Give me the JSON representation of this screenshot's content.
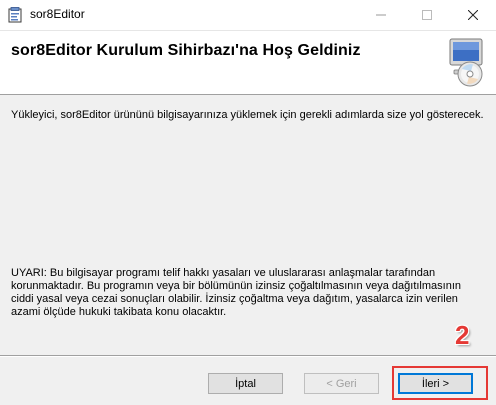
{
  "window": {
    "title": "sor8Editor",
    "icons": {
      "app": "installer-icon",
      "minimize": "minimize-icon",
      "maximize": "maximize-icon",
      "close": "close-icon"
    }
  },
  "header": {
    "title": "sor8Editor Kurulum Sihirbazı'na Hoş Geldiniz",
    "icon": "computer-cd-icon"
  },
  "body": {
    "intro": "Yükleyici, sor8Editor ürününü bilgisayarınıza yüklemek için gerekli adımlarda size yol gösterecek.",
    "warning": "UYARI: Bu bilgisayar programı telif hakkı yasaları ve uluslararası anlaşmalar tarafından korunmaktadır. Bu programın veya bir bölümünün izinsiz çoğaltılmasının veya dağıtılmasının ciddi yasal veya cezai sonuçları olabilir. İzinsiz çoğaltma veya dağıtım, yasalarca izin verilen azami ölçüde hukuki takibata konu olacaktır."
  },
  "buttons": {
    "cancel": "İptal",
    "back": "< Geri",
    "next": "İleri >"
  },
  "annotation": {
    "step_number": "2",
    "color": "#e53935"
  }
}
